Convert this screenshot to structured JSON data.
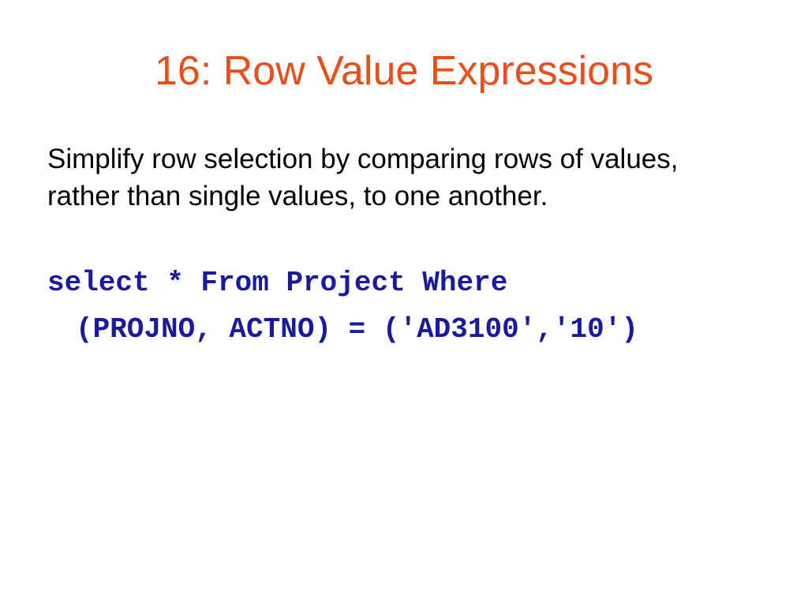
{
  "slide": {
    "title": "16: Row Value Expressions",
    "description": "Simplify row selection by comparing rows of values, rather than single values, to one another.",
    "code": {
      "line1": "select * From Project Where",
      "line2": "(PROJNO, ACTNO) = ('AD3100','10')"
    }
  }
}
